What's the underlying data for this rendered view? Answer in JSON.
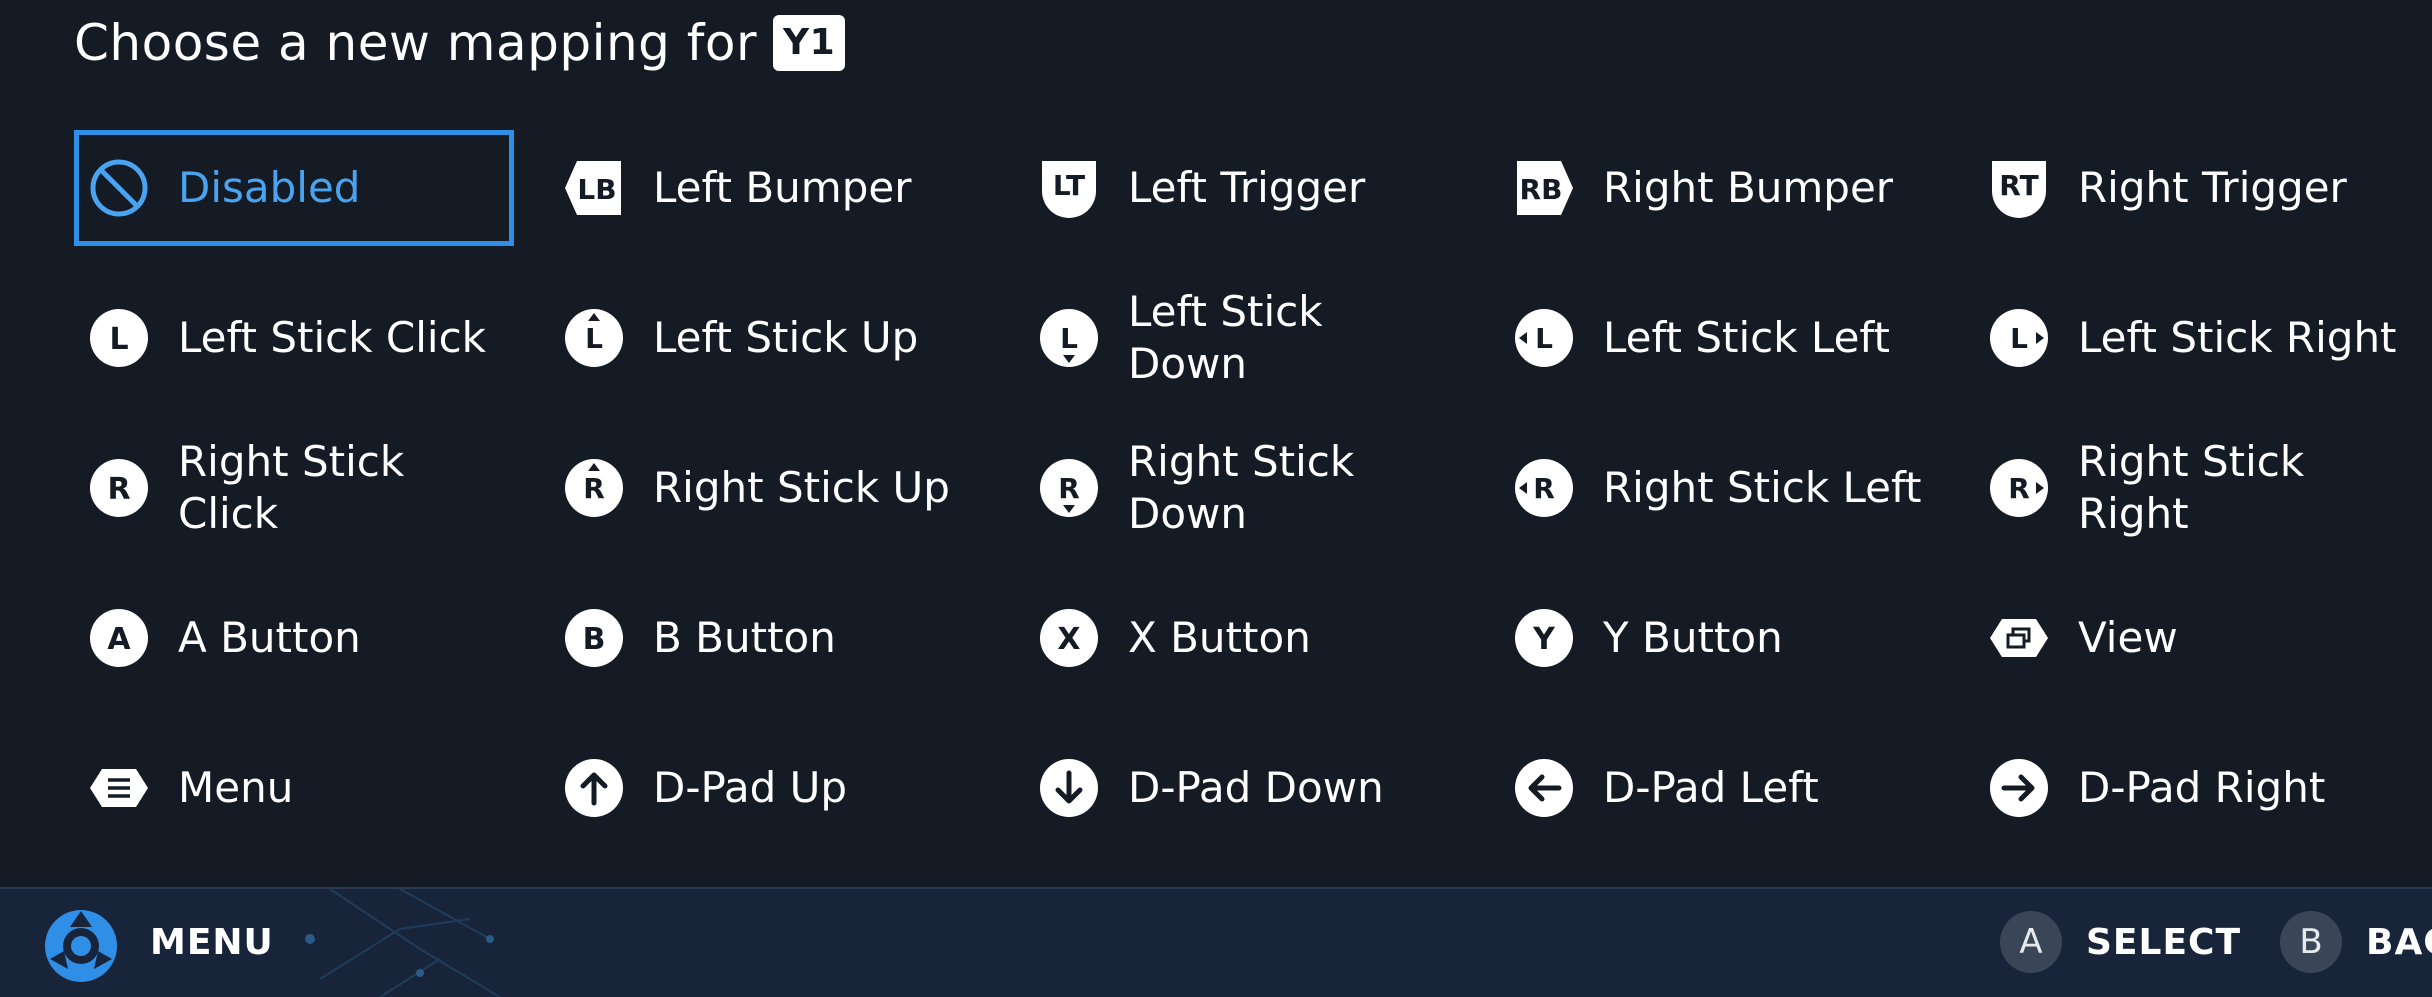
{
  "header": {
    "prompt": "Choose a new mapping for",
    "key": "Y1"
  },
  "options": [
    {
      "icon": "disabled-icon",
      "label": "Disabled",
      "selected": true
    },
    {
      "icon": "left-bumper-icon",
      "label": "Left Bumper",
      "badge": "LB"
    },
    {
      "icon": "left-trigger-icon",
      "label": "Left Trigger",
      "badge": "LT"
    },
    {
      "icon": "right-bumper-icon",
      "label": "Right Bumper",
      "badge": "RB"
    },
    {
      "icon": "right-trigger-icon",
      "label": "Right Trigger",
      "badge": "RT"
    },
    {
      "icon": "left-stick-click-icon",
      "label": "Left Stick Click",
      "badge": "L"
    },
    {
      "icon": "left-stick-up-icon",
      "label": "Left Stick Up",
      "badge": "L"
    },
    {
      "icon": "left-stick-down-icon",
      "label": "Left Stick Down",
      "badge": "L"
    },
    {
      "icon": "left-stick-left-icon",
      "label": "Left Stick Left",
      "badge": "L"
    },
    {
      "icon": "left-stick-right-icon",
      "label": "Left Stick Right",
      "badge": "L"
    },
    {
      "icon": "right-stick-click-icon",
      "label": "Right Stick Click",
      "badge": "R"
    },
    {
      "icon": "right-stick-up-icon",
      "label": "Right Stick Up",
      "badge": "R"
    },
    {
      "icon": "right-stick-down-icon",
      "label": "Right Stick Down",
      "badge": "R"
    },
    {
      "icon": "right-stick-left-icon",
      "label": "Right Stick Left",
      "badge": "R"
    },
    {
      "icon": "right-stick-right-icon",
      "label": "Right Stick Right",
      "badge": "R"
    },
    {
      "icon": "a-button-icon",
      "label": "A Button",
      "badge": "A"
    },
    {
      "icon": "b-button-icon",
      "label": "B Button",
      "badge": "B"
    },
    {
      "icon": "x-button-icon",
      "label": "X Button",
      "badge": "X"
    },
    {
      "icon": "y-button-icon",
      "label": "Y Button",
      "badge": "Y"
    },
    {
      "icon": "view-icon",
      "label": "View"
    },
    {
      "icon": "menu-icon",
      "label": "Menu"
    },
    {
      "icon": "dpad-up-icon",
      "label": "D-Pad Up"
    },
    {
      "icon": "dpad-down-icon",
      "label": "D-Pad Down"
    },
    {
      "icon": "dpad-left-icon",
      "label": "D-Pad Left"
    },
    {
      "icon": "dpad-right-icon",
      "label": "D-Pad Right"
    }
  ],
  "footer": {
    "menu_label": "MENU",
    "hints": [
      {
        "button": "A",
        "label": "SELECT"
      },
      {
        "button": "B",
        "label": "BAC"
      }
    ]
  },
  "colors": {
    "background": "#141b25",
    "accent": "#2f8fe6",
    "footer": "#18243a"
  }
}
